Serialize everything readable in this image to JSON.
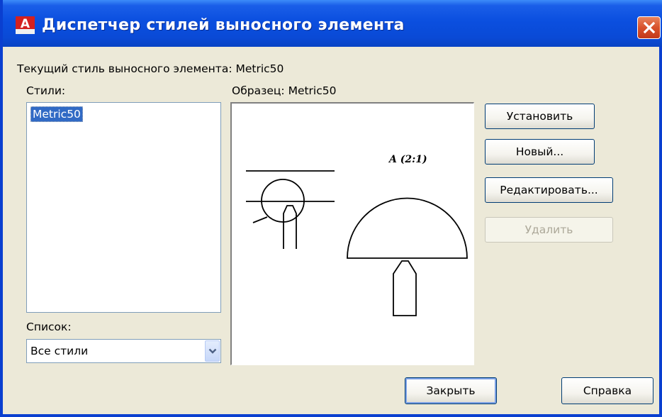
{
  "window": {
    "title": "Диспетчер стилей выносного элемента",
    "app_icon_letter": "A",
    "close_icon": "close-icon",
    "accent_color": "#0a4ad6",
    "close_color": "#d8512b"
  },
  "current_style": {
    "text": "Текущий стиль выносного элемента: Metric50"
  },
  "styles": {
    "label": "Стили:",
    "items": [
      "Metric50"
    ],
    "selected": "Metric50"
  },
  "list_filter": {
    "label": "Список:",
    "value": "Все стили",
    "arrow_icon": "chevron-down-icon"
  },
  "preview": {
    "label": "Образец: Metric50",
    "sample_text": "A (2:1)"
  },
  "buttons": {
    "set_current": "Установить",
    "new": "Новый...",
    "modify": "Редактировать...",
    "delete": "Удалить",
    "close": "Закрыть",
    "help": "Справка"
  }
}
